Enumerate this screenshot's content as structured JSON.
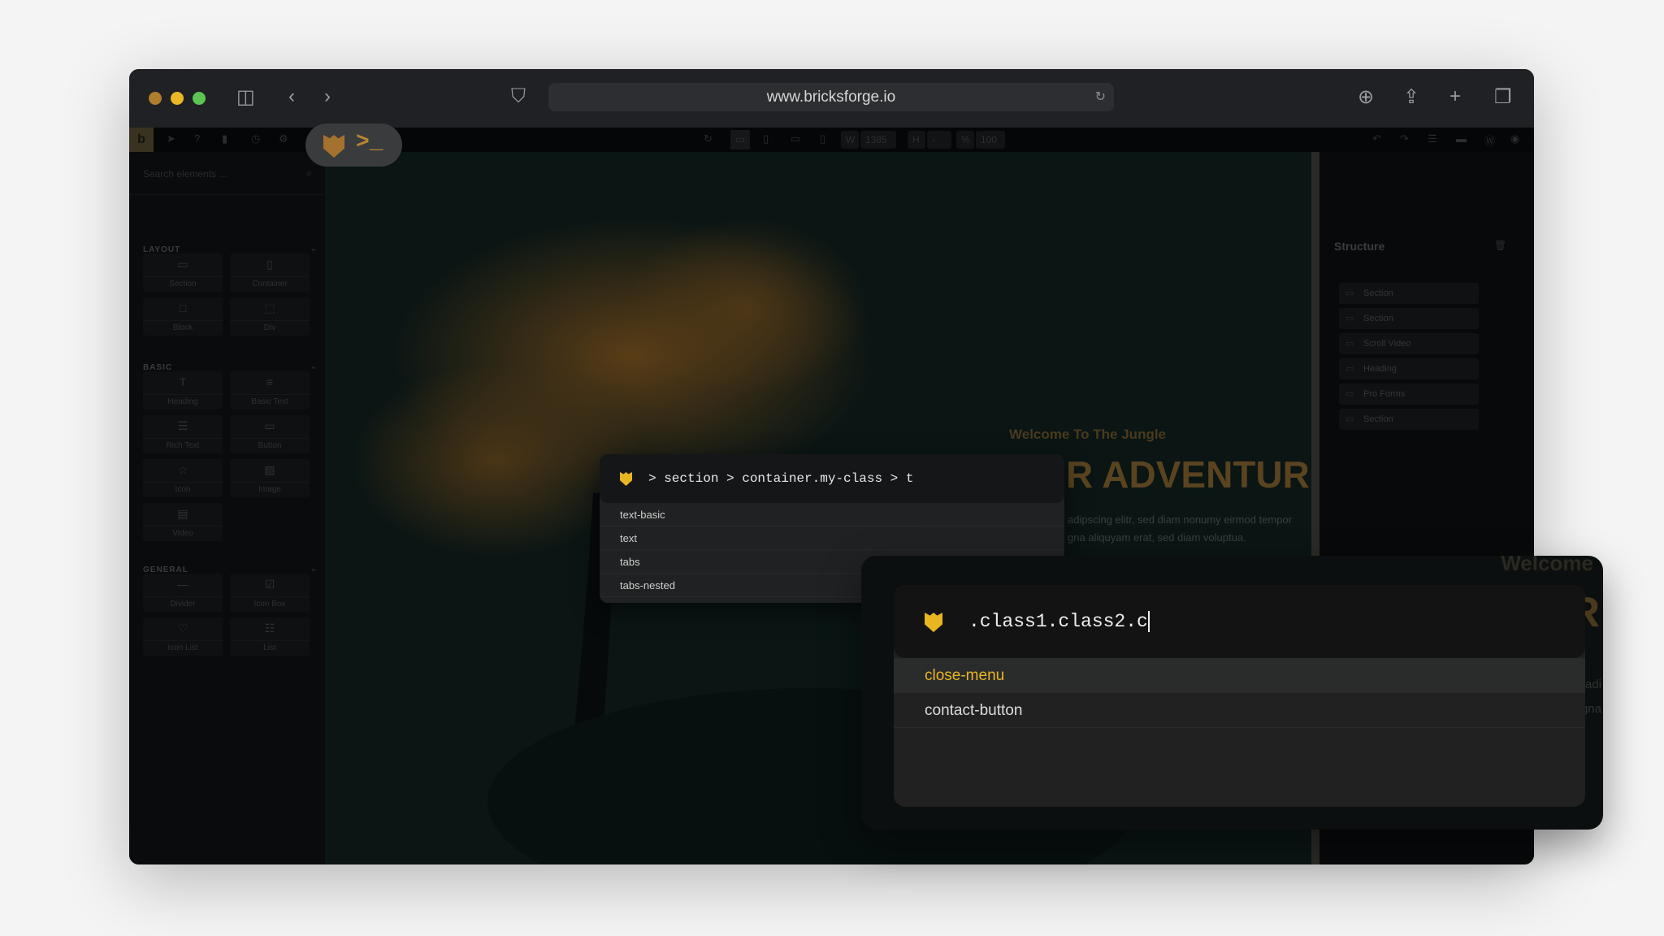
{
  "browser": {
    "url": "www.bricksforge.io",
    "traffic_colors": [
      "#b07d2b",
      "#e9b824",
      "#5cc453"
    ]
  },
  "toolbar": {
    "logo": "b",
    "width_label": "W",
    "width_value": "1385",
    "height_label": "H",
    "height_value": "-",
    "zoom_label": "%",
    "zoom_value": "100"
  },
  "sidebar": {
    "search_placeholder": "Search elements ...",
    "sections": [
      {
        "title": "LAYOUT",
        "items": [
          {
            "label": "Section",
            "icon": "▭"
          },
          {
            "label": "Container",
            "icon": "▯"
          },
          {
            "label": "Block",
            "icon": "□"
          },
          {
            "label": "Div",
            "icon": "⬚"
          }
        ]
      },
      {
        "title": "BASIC",
        "items": [
          {
            "label": "Heading",
            "icon": "T"
          },
          {
            "label": "Basic Text",
            "icon": "≡"
          },
          {
            "label": "Rich Text",
            "icon": "☰"
          },
          {
            "label": "Button",
            "icon": "▭"
          },
          {
            "label": "Icon",
            "icon": "☆"
          },
          {
            "label": "Image",
            "icon": "▨"
          },
          {
            "label": "Video",
            "icon": "▤"
          }
        ]
      },
      {
        "title": "GENERAL",
        "items": [
          {
            "label": "Divider",
            "icon": "—"
          },
          {
            "label": "Icon Box",
            "icon": "☑"
          },
          {
            "label": "Icon List",
            "icon": "♡"
          },
          {
            "label": "List",
            "icon": "☷"
          }
        ]
      }
    ]
  },
  "canvas": {
    "eyebrow": "Welcome To The Jungle",
    "heading": "R ADVENTURE",
    "body_line1": "adipscing elitr, sed diam nonumy eirmod tempor",
    "body_line2": "gna aliquyam erat, sed diam voluptua.",
    "right_fragment_1": "Welcome",
    "right_fragment_2": "R",
    "right_fragment_3": "adi",
    "right_fragment_4": "gna"
  },
  "structure": {
    "title": "Structure",
    "items": [
      "Section",
      "Section",
      "Scroll Video",
      "Heading",
      "Pro Forms",
      "Section"
    ]
  },
  "pill": {
    "prompt": ">_"
  },
  "popup1": {
    "query": "> section > container.my-class > t",
    "suggestions": [
      "text-basic",
      "text",
      "tabs",
      "tabs-nested"
    ]
  },
  "popup2": {
    "query": ".class1.class2.c",
    "suggestions": [
      "close-menu",
      "contact-button"
    ],
    "highlight_color": "#e8b623"
  }
}
